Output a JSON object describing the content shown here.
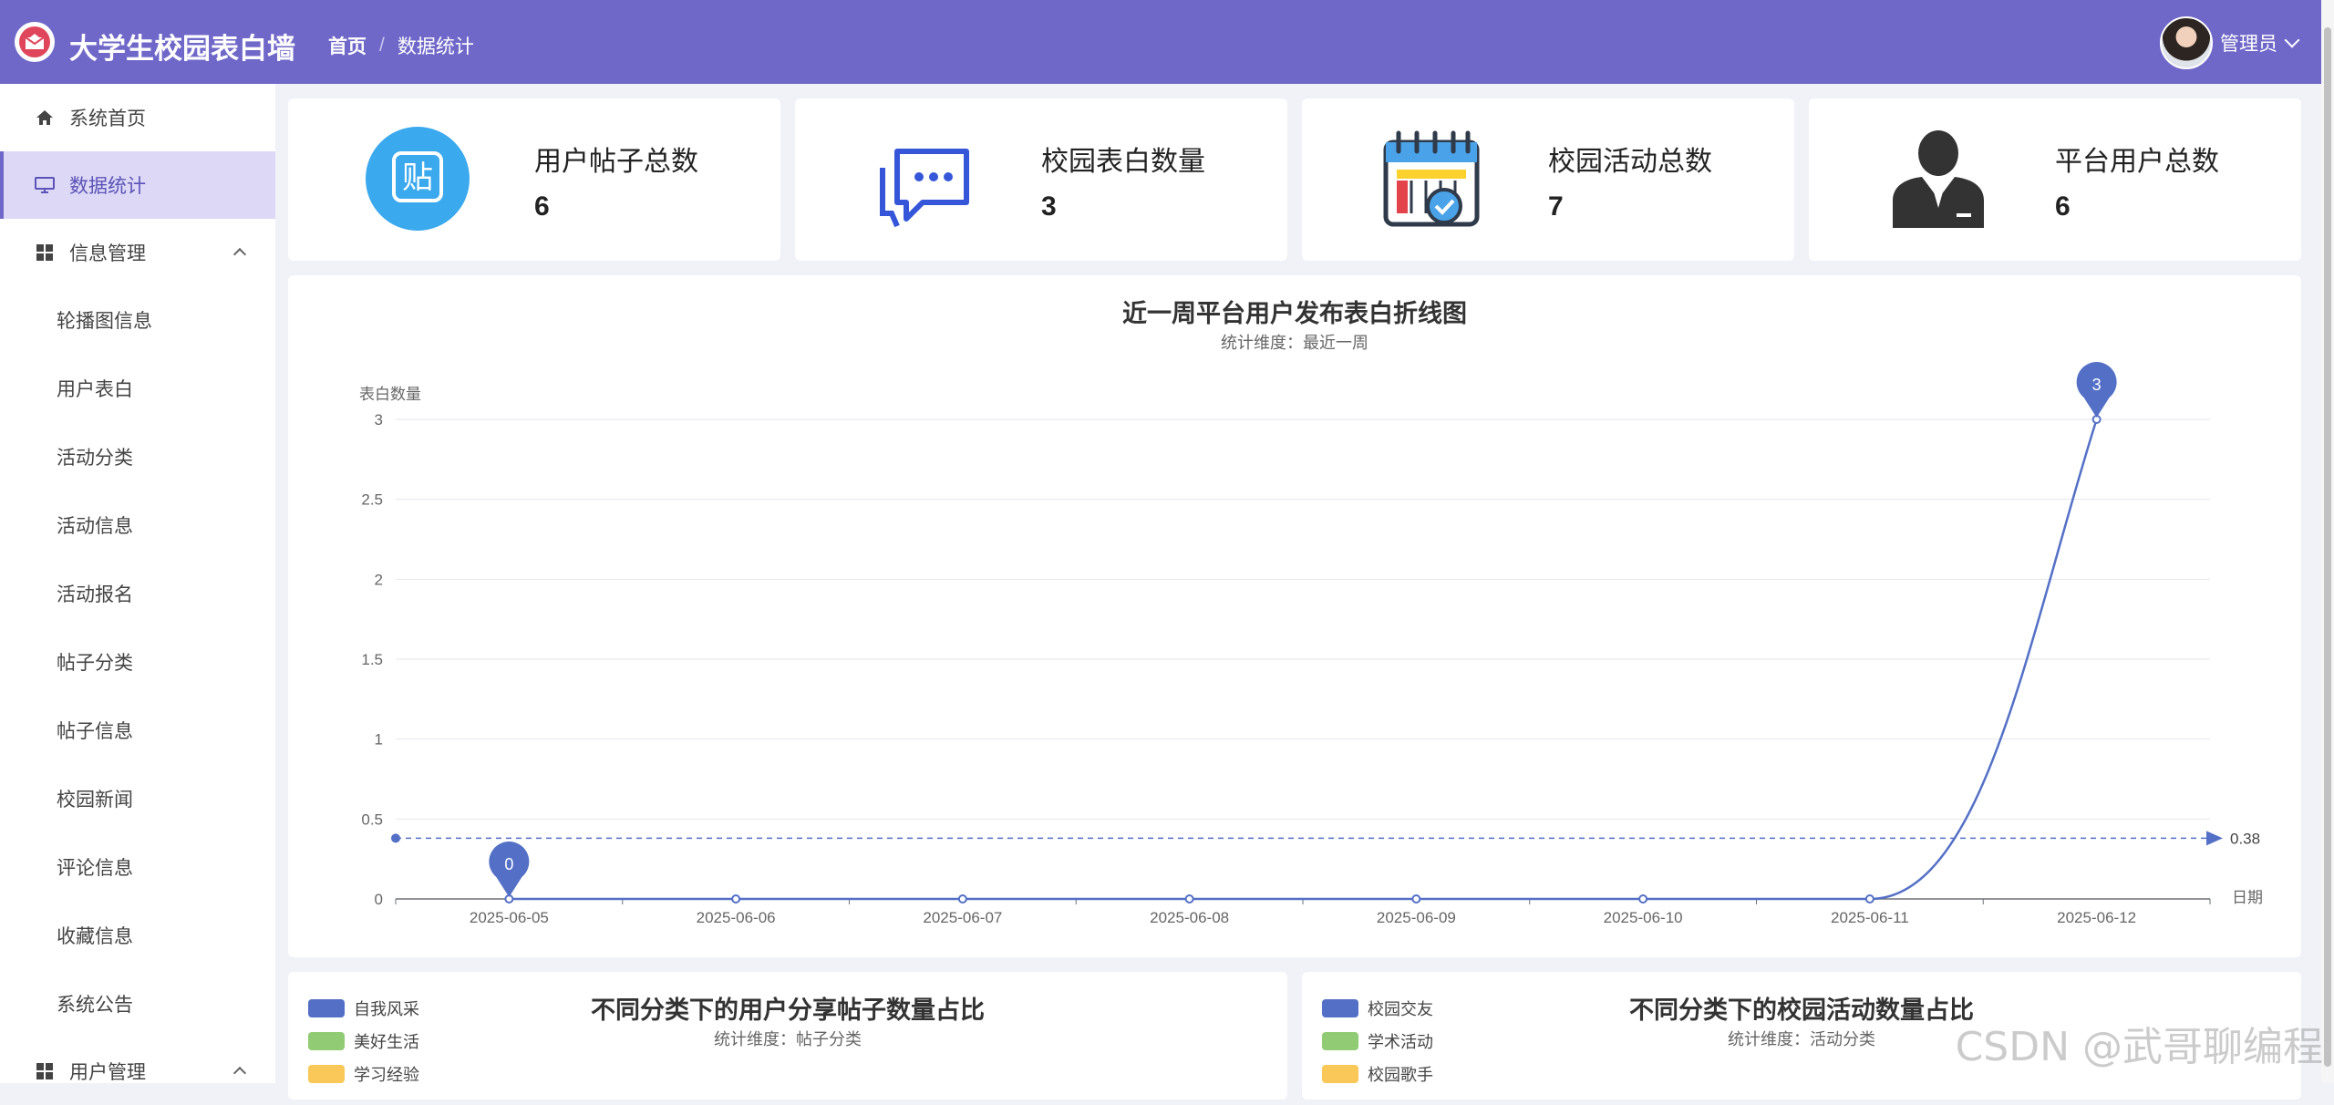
{
  "header": {
    "app_title": "大学生校园表白墙",
    "breadcrumb_home": "首页",
    "breadcrumb_sep": "/",
    "breadcrumb_current": "数据统计",
    "user_name": "管理员"
  },
  "sidebar": {
    "items": [
      {
        "label": "系统首页",
        "icon": "home-icon"
      },
      {
        "label": "数据统计",
        "icon": "monitor-icon",
        "active": true
      },
      {
        "label": "信息管理",
        "icon": "grid-icon",
        "expanded": true
      },
      {
        "label": "轮播图信息"
      },
      {
        "label": "用户表白"
      },
      {
        "label": "活动分类"
      },
      {
        "label": "活动信息"
      },
      {
        "label": "活动报名"
      },
      {
        "label": "帖子分类"
      },
      {
        "label": "帖子信息"
      },
      {
        "label": "校园新闻"
      },
      {
        "label": "评论信息"
      },
      {
        "label": "收藏信息"
      },
      {
        "label": "系统公告"
      },
      {
        "label": "用户管理",
        "icon": "grid-icon"
      }
    ]
  },
  "cards": [
    {
      "label": "用户帖子总数",
      "value": "6",
      "icon": "post-icon"
    },
    {
      "label": "校园表白数量",
      "value": "3",
      "icon": "chat-icon"
    },
    {
      "label": "校园活动总数",
      "value": "7",
      "icon": "calendar-icon"
    },
    {
      "label": "平台用户总数",
      "value": "6",
      "icon": "user-icon"
    }
  ],
  "line_chart": {
    "title": "近一周平台用户发布表白折线图",
    "subtitle": "统计维度：最近一周",
    "ylabel": "表白数量",
    "xlabel": "日期",
    "min_label": "0",
    "max_label": "3",
    "avg_label": "0.38"
  },
  "chart_data": [
    {
      "type": "line",
      "title": "近一周平台用户发布表白折线图",
      "subtitle": "统计维度：最近一周",
      "xlabel": "日期",
      "ylabel": "表白数量",
      "x": [
        "2025-06-05",
        "2025-06-06",
        "2025-06-07",
        "2025-06-08",
        "2025-06-09",
        "2025-06-10",
        "2025-06-11",
        "2025-06-12"
      ],
      "values": [
        0,
        0,
        0,
        0,
        0,
        0,
        0,
        3
      ],
      "ylim": [
        0,
        3
      ],
      "yticks": [
        "0",
        "0.5",
        "1",
        "1.5",
        "2",
        "2.5",
        "3"
      ],
      "mark_points": {
        "min": 0,
        "max": 3
      },
      "mark_line_average": 0.38,
      "grid": true,
      "color": "#5470c6"
    },
    {
      "type": "pie",
      "title": "不同分类下的用户分享帖子数量占比",
      "subtitle": "统计维度：帖子分类",
      "legend": [
        "自我风采",
        "美好生活",
        "学习经验"
      ],
      "legend_position": "top-left"
    },
    {
      "type": "pie",
      "title": "不同分类下的校园活动数量占比",
      "subtitle": "统计维度：活动分类",
      "legend": [
        "校园交友",
        "学术活动",
        "校园歌手"
      ],
      "legend_position": "top-left"
    }
  ],
  "legend_colors": [
    "#5470c6",
    "#91cc75",
    "#fac858"
  ],
  "watermark": "CSDN @武哥聊编程"
}
